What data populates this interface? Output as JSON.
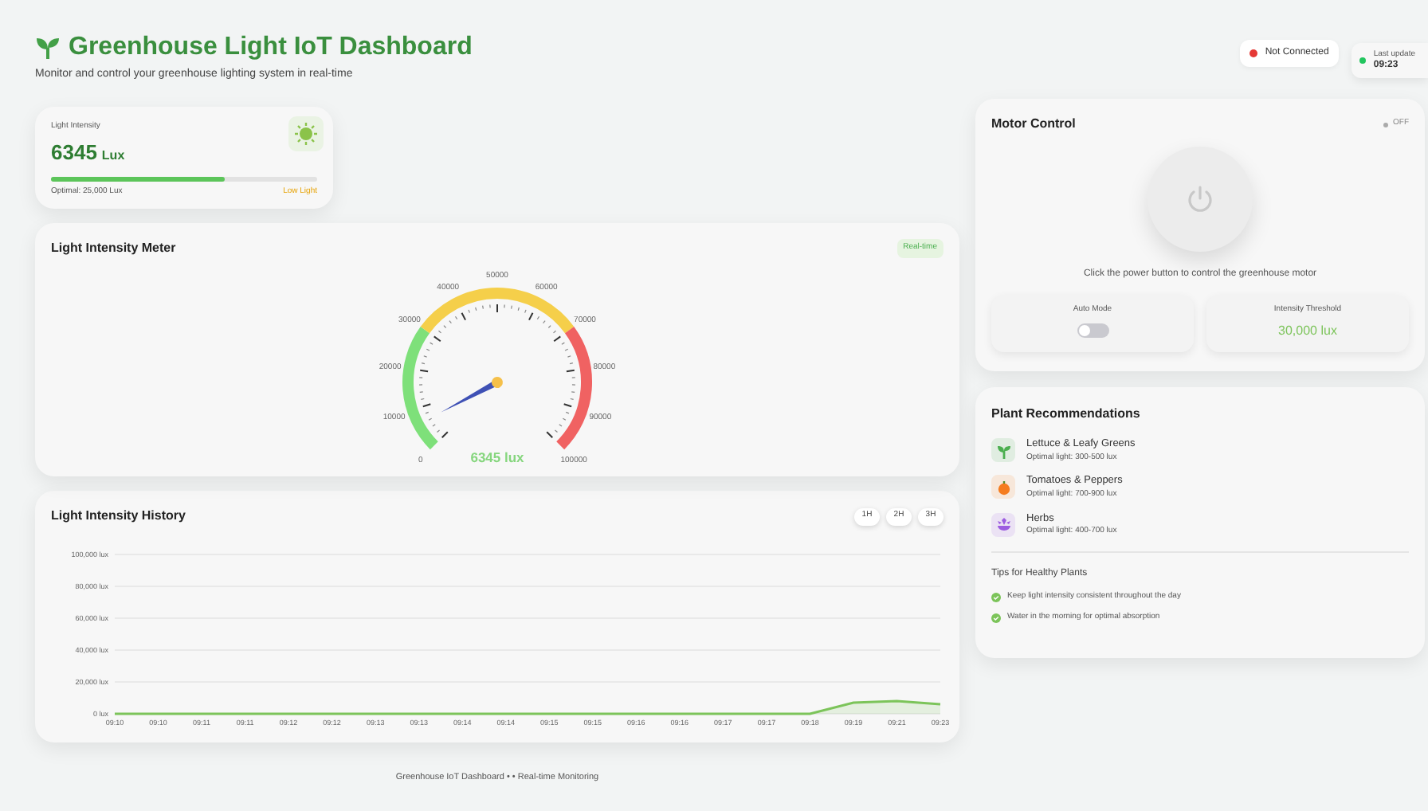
{
  "header": {
    "title": "Greenhouse Light IoT Dashboard",
    "subtitle": "Monitor and control your greenhouse lighting system in real-time",
    "connection": {
      "label": "Not Connected",
      "connected": false
    },
    "last_update": {
      "label": "Last update",
      "time": "09:23"
    }
  },
  "light_card": {
    "label": "Light Intensity",
    "value": "6345",
    "unit": "Lux",
    "level": 0.65,
    "optimal": "Optimal: 25,000 Lux",
    "status": "Low Light"
  },
  "meter": {
    "title": "Light Intensity Meter",
    "badge": "Real-time",
    "tick_labels": [
      "0",
      "10000",
      "20000",
      "30000",
      "40000",
      "50000",
      "60000",
      "70000",
      "80000",
      "90000",
      "100000"
    ],
    "reading": "6345 lux"
  },
  "history": {
    "title": "Light Intensity History",
    "ranges": [
      {
        "label": "1H",
        "selected": false
      },
      {
        "label": "2H",
        "selected": false
      },
      {
        "label": "3H",
        "selected": false
      }
    ],
    "chart_data": {
      "type": "line",
      "categories": [
        "09:10",
        "09:10",
        "09:11",
        "09:11",
        "09:12",
        "09:12",
        "09:13",
        "09:13",
        "09:14",
        "09:14",
        "09:15",
        "09:15",
        "09:16",
        "09:16",
        "09:17",
        "09:17",
        "09:18",
        "09:19",
        "09:21",
        "09:23"
      ],
      "series": [
        {
          "color": "#7cc45a",
          "values": [
            0,
            0,
            0,
            0,
            0,
            0,
            0,
            0,
            0,
            0,
            0,
            0,
            0,
            0,
            0,
            0,
            0,
            7000,
            8000,
            6000
          ]
        }
      ],
      "grid": true,
      "ylim": [
        0,
        100000
      ],
      "yticks": [
        {
          "value": 0,
          "label": "0 lux"
        },
        {
          "value": 20000,
          "label": "20,000 lux"
        },
        {
          "value": 40000,
          "label": "40,000 lux"
        },
        {
          "value": 60000,
          "label": "60,000 lux"
        },
        {
          "value": 80000,
          "label": "80,000 lux"
        },
        {
          "value": 100000,
          "label": "100,000 lux"
        }
      ]
    }
  },
  "motor": {
    "title": "Motor Control",
    "on": false,
    "status": "OFF",
    "hint": "Click the power button to control the greenhouse motor",
    "auto_mode": {
      "label": "Auto Mode",
      "on": false
    },
    "threshold": {
      "label": "Intensity Threshold",
      "value": "30,000 lux"
    }
  },
  "plants": {
    "title": "Plant Recommendations",
    "items": [
      {
        "kind": "sprout",
        "name": "Lettuce & Leafy Greens",
        "light": "Optimal light: 300-500 lux",
        "color": "#4caf50"
      },
      {
        "kind": "fruit",
        "name": "Tomatoes & Peppers",
        "light": "Optimal light: 700-900 lux",
        "color": "#f57c1f"
      },
      {
        "kind": "flower",
        "name": "Herbs",
        "light": "Optimal light: 400-700 lux",
        "color": "#9c5ce0"
      }
    ],
    "tips_title": "Tips for Healthy Plants",
    "tips": [
      "Keep light intensity consistent throughout the day",
      "Water in the morning for optimal absorption"
    ]
  },
  "footer": "Greenhouse IoT Dashboard • • Real-time Monitoring"
}
